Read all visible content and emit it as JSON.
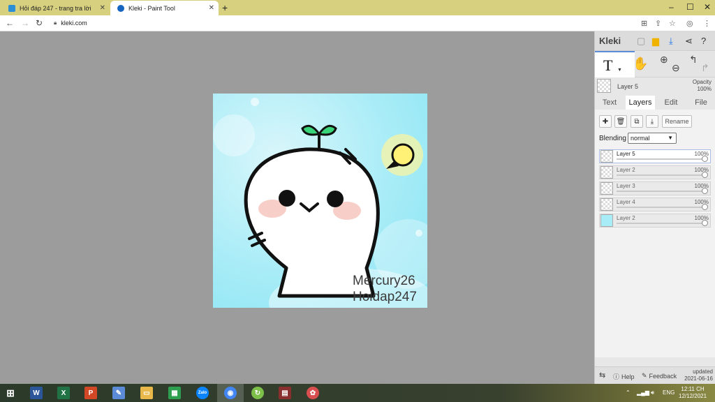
{
  "browser": {
    "tabs": [
      {
        "title": "Hỏi đáp 247 - trang tra lời",
        "active": false
      },
      {
        "title": "Kleki - Paint Tool",
        "active": true
      }
    ],
    "new_tab_icon": "+",
    "url": "kleki.com",
    "window_controls": [
      "–",
      "☐",
      "✕"
    ]
  },
  "canvas": {
    "watermark_lines": [
      "Mercury26",
      "Hoidap247"
    ]
  },
  "panel": {
    "logo": "Kleki",
    "active_tool": "T",
    "current_layer": "Layer 5",
    "opacity_label": "Opacity",
    "opacity_value": "100%",
    "tabs": [
      "Text",
      "Layers",
      "Edit",
      "File"
    ],
    "active_tab": "Layers",
    "rename_label": "Rename",
    "blending_label": "Blending",
    "blending_value": "normal",
    "layers": [
      {
        "name": "Layer 5",
        "opacity": "100%",
        "selected": true
      },
      {
        "name": "Layer 2",
        "opacity": "100%",
        "selected": false
      },
      {
        "name": "Layer 3",
        "opacity": "100%",
        "selected": false
      },
      {
        "name": "Layer 4",
        "opacity": "100%",
        "selected": false
      },
      {
        "name": "Layer 2",
        "opacity": "100%",
        "selected": false
      }
    ],
    "footer": {
      "help": "Help",
      "feedback": "Feedback",
      "updated_label": "updated",
      "updated_date": "2021-06-16"
    }
  },
  "taskbar": {
    "lang": "ENG",
    "time": "12:11 CH",
    "date": "12/12/2021"
  },
  "colors": {
    "tab_strip": "#d7d07e",
    "canvas_bg": "#9c9c9c",
    "accent_blue": "#1a73e8"
  }
}
